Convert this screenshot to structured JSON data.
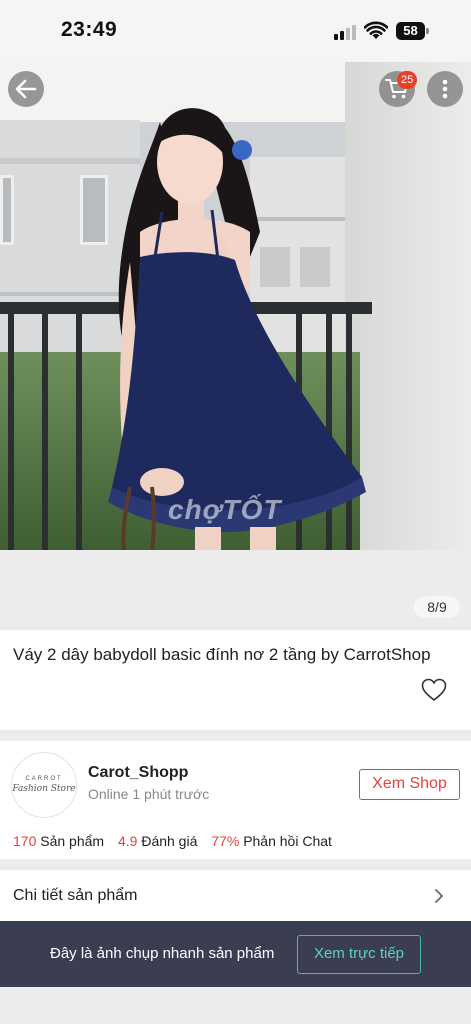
{
  "status_bar": {
    "time": "23:49",
    "battery": "58"
  },
  "nav": {
    "cart_count": "25",
    "back_icon": "arrow-left-icon",
    "cart_icon": "cart-icon",
    "more_icon": "more-vertical-icon"
  },
  "gallery": {
    "watermark": "chợTỐT",
    "counter": "8/9"
  },
  "product": {
    "title": "Váy 2 dây babydoll basic đính nơ 2 tầng by CarrotShop",
    "favorite_icon": "heart-outline-icon"
  },
  "shop": {
    "avatar_logo_top": "CARROT",
    "avatar_logo_script": "Fashion Store",
    "name": "Carot_Shopp",
    "online_status": "Online 1 phút trước",
    "view_shop_label": "Xem Shop",
    "stats": {
      "products_count": "170",
      "products_label": "Sản phẩm",
      "rating_value": "4.9",
      "rating_label": "Đánh giá",
      "chat_response_value": "77%",
      "chat_response_label": "Phản hồi Chat"
    }
  },
  "details": {
    "label": "Chi tiết sản phẩm"
  },
  "snapshot": {
    "message": "Đây là ảnh chụp nhanh sản phẩm",
    "live_view_label": "Xem trực tiếp"
  },
  "colors": {
    "accent_red": "#e5413a",
    "snapshot_bg": "#3b3e50",
    "live_button_teal": "#46b9ad"
  }
}
